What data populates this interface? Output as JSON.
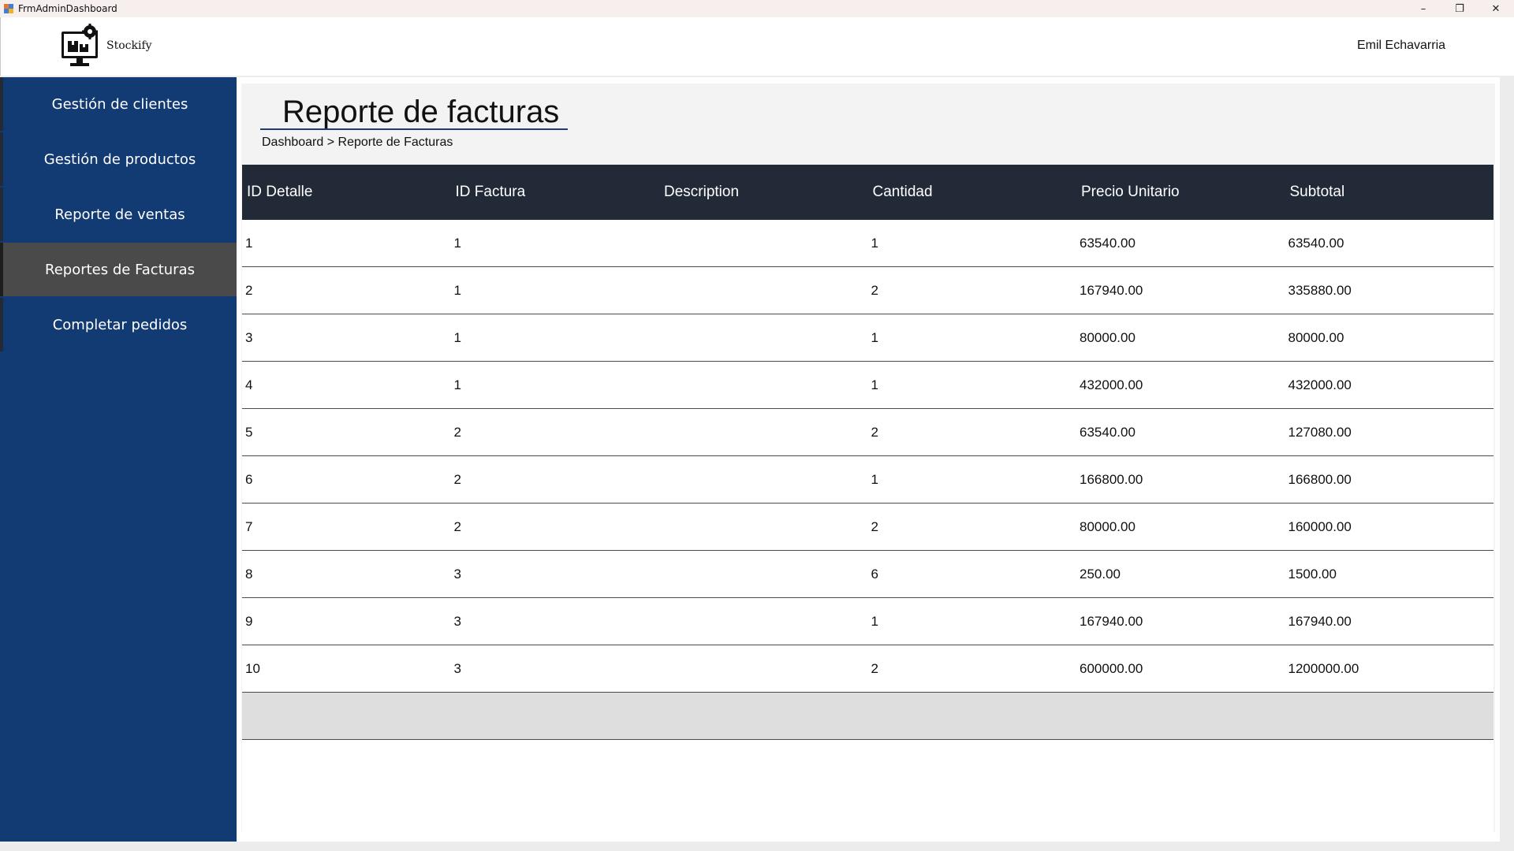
{
  "window": {
    "title": "FrmAdminDashboard",
    "controls": {
      "minimize": "–",
      "restore": "❐",
      "close": "✕"
    }
  },
  "header": {
    "brand": "Stockify",
    "user_name": "Emil Echavarria"
  },
  "sidebar": {
    "items": [
      {
        "label": "Gestión de clientes",
        "active": false
      },
      {
        "label": "Gestión de productos",
        "active": false
      },
      {
        "label": "Reporte de ventas",
        "active": false
      },
      {
        "label": "Reportes de Facturas",
        "active": true
      },
      {
        "label": "Completar pedidos",
        "active": false
      }
    ]
  },
  "page": {
    "title": "Reporte de facturas",
    "breadcrumb": "Dashboard > Reporte de Facturas"
  },
  "table": {
    "columns": [
      "ID Detalle",
      "ID Factura",
      "Description",
      "Cantidad",
      "Precio Unitario",
      "Subtotal"
    ],
    "rows": [
      [
        "1",
        "1",
        "",
        "1",
        "63540.00",
        "63540.00"
      ],
      [
        "2",
        "1",
        "",
        "2",
        "167940.00",
        "335880.00"
      ],
      [
        "3",
        "1",
        "",
        "1",
        "80000.00",
        "80000.00"
      ],
      [
        "4",
        "1",
        "",
        "1",
        "432000.00",
        "432000.00"
      ],
      [
        "5",
        "2",
        "",
        "2",
        "63540.00",
        "127080.00"
      ],
      [
        "6",
        "2",
        "",
        "1",
        "166800.00",
        "166800.00"
      ],
      [
        "7",
        "2",
        "",
        "2",
        "80000.00",
        "160000.00"
      ],
      [
        "8",
        "3",
        "",
        "6",
        "250.00",
        "1500.00"
      ],
      [
        "9",
        "3",
        "",
        "1",
        "167940.00",
        "167940.00"
      ],
      [
        "10",
        "3",
        "",
        "2",
        "600000.00",
        "1200000.00"
      ]
    ]
  },
  "colors": {
    "sidebar_bg": "#123a73",
    "sidebar_active": "#4a4a4a",
    "table_header_bg": "#222a38",
    "title_underline": "#1a3d73"
  },
  "icons": {
    "app": "app-icon",
    "logo": "monitor-gear-logo-icon"
  }
}
